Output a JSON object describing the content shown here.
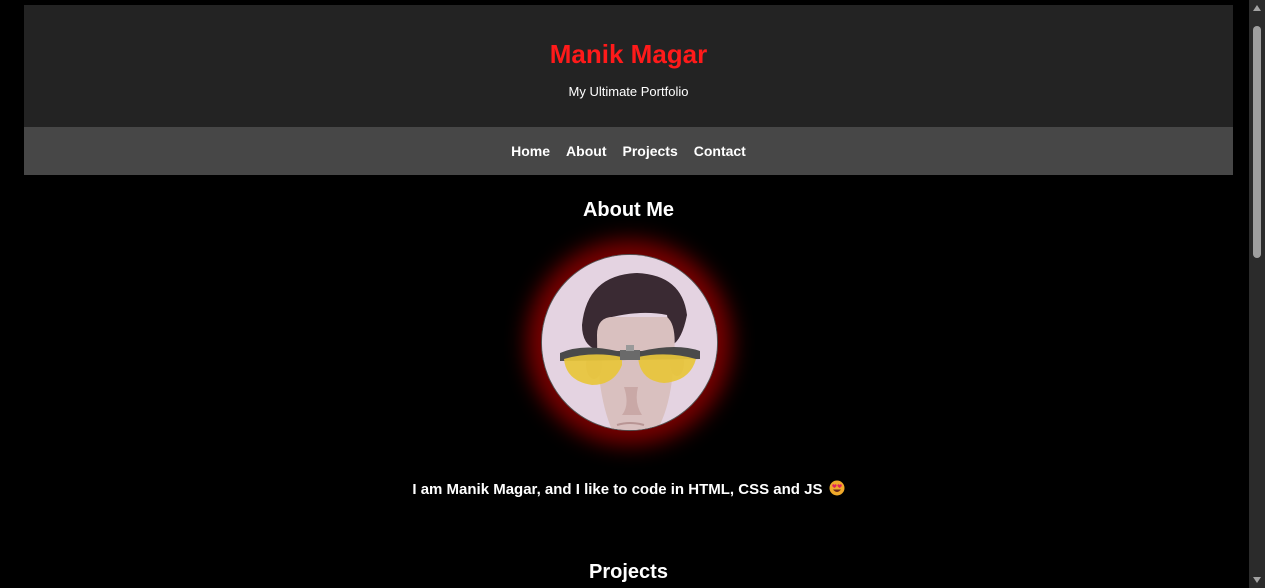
{
  "header": {
    "title": "Manik Magar",
    "subtitle": "My Ultimate Portfolio"
  },
  "nav": {
    "items": [
      {
        "label": "Home"
      },
      {
        "label": "About"
      },
      {
        "label": "Projects"
      },
      {
        "label": "Contact"
      }
    ]
  },
  "about": {
    "heading": "About Me",
    "avatar_icon": "profile-photo",
    "text": "I am Manik Magar, and I like to code in HTML, CSS and JS",
    "emoji_icon": "smiling-face-with-heart-eyes-icon"
  },
  "projects": {
    "heading": "Projects"
  },
  "colors": {
    "page_background": "#000000",
    "header_background": "#232323",
    "nav_background": "#474747",
    "title_color": "#ff1a1a",
    "glow_color": "#a00000"
  }
}
